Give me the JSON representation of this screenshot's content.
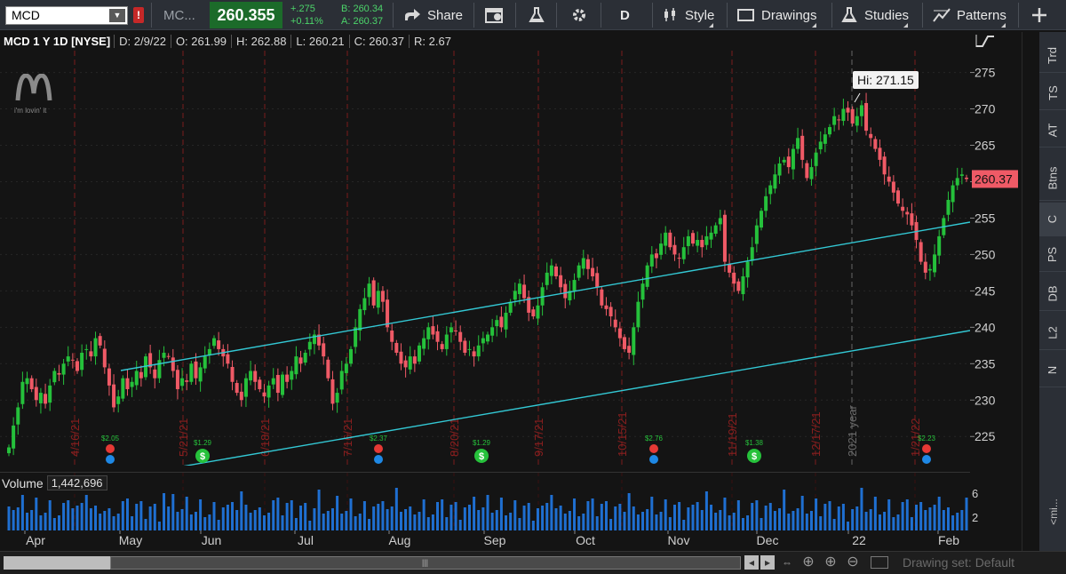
{
  "toolbar": {
    "symbol": "MCD",
    "alert_flag": "!",
    "quote_symbol": "MC...",
    "last_price": "260.355",
    "net_change": "+.275",
    "pct_change": "+0.11%",
    "bid": "B: 260.34",
    "ask": "A: 260.37",
    "share": "Share",
    "aggregation": "D",
    "style": "Style",
    "drawings": "Drawings",
    "studies": "Studies",
    "patterns": "Patterns"
  },
  "header": {
    "title": "MCD 1 Y 1D [NYSE]",
    "date": "D: 2/9/22",
    "open": "O: 261.99",
    "high": "H: 262.88",
    "low": "L: 260.21",
    "close": "C: 260.37",
    "range": "R: 2.67"
  },
  "logo": {
    "tagline": "i'm lovin' it"
  },
  "chart_data": {
    "type": "candlestick",
    "title": "MCD 1 Y 1D [NYSE]",
    "price_ylim": [
      221,
      278
    ],
    "price_ticks": [
      225,
      230,
      235,
      240,
      245,
      250,
      255,
      260,
      265,
      270,
      275
    ],
    "volume_ticks": [
      "6",
      "2"
    ],
    "last_price_label": "260.37",
    "high_label": "Hi: 271.15",
    "month_labels": [
      "Apr",
      "May",
      "Jun",
      "Jul",
      "Aug",
      "Sep",
      "Oct",
      "Nov",
      "Dec",
      "22",
      "Feb"
    ],
    "period_markers": [
      "4/16/21",
      "5/21/21",
      "6/18/21",
      "7/16/21",
      "8/20/21",
      "9/17/21",
      "10/15/21",
      "11/19/21",
      "12/17/21",
      "1/21/22"
    ],
    "year_marker": "2021 year",
    "dividends": [
      "$1.29",
      "$1.29",
      "$1.29",
      "$1.38"
    ],
    "earnings": [
      "$2.05",
      "$2.37",
      "$2.76",
      "$2.23"
    ],
    "closes": [
      223.5,
      226.5,
      229,
      232.5,
      233,
      231.5,
      230,
      231,
      229.5,
      232,
      234,
      233.5,
      235,
      236,
      235.5,
      234,
      236.5,
      237,
      236,
      238.5,
      237.5,
      234.5,
      232,
      229,
      230.5,
      233,
      231.5,
      232.5,
      234,
      233,
      236,
      234.5,
      233,
      235.5,
      236.5,
      236,
      234,
      231.5,
      233,
      232.5,
      235,
      233,
      234.5,
      236,
      237,
      238.5,
      237,
      236,
      235,
      232.5,
      231,
      230,
      233,
      234,
      232.5,
      231.5,
      230.5,
      232,
      233,
      231,
      233.5,
      232.5,
      234,
      236,
      235,
      236.5,
      238,
      239,
      237.5,
      236,
      233,
      229.5,
      231,
      234,
      235,
      237,
      240,
      242.5,
      244,
      246,
      243,
      245,
      243.5,
      240,
      238,
      236.5,
      235,
      234.5,
      236,
      235,
      237.5,
      238.5,
      240,
      239,
      238,
      237,
      239,
      240,
      239.5,
      238,
      236.5,
      237,
      236,
      237.5,
      238.5,
      239,
      240,
      241,
      240,
      242,
      243.5,
      245,
      246,
      244,
      242,
      241.5,
      243,
      245.5,
      247.5,
      248.5,
      247,
      245.5,
      244,
      245,
      246.5,
      248.5,
      249.5,
      248,
      247,
      245.5,
      243,
      242.5,
      241.5,
      240,
      238.5,
      237,
      236.5,
      240,
      243.5,
      246,
      248.5,
      250,
      249.5,
      251.5,
      253,
      251,
      250,
      249.5,
      251,
      252.5,
      251.5,
      252,
      251,
      252.5,
      253,
      254,
      255,
      249,
      247.5,
      246,
      245,
      247,
      249,
      251,
      254,
      256,
      258,
      259.5,
      261,
      262.5,
      263,
      262,
      264.5,
      266,
      263,
      260.5,
      262,
      264,
      265.5,
      266.5,
      267.5,
      269,
      268.5,
      270,
      269.5,
      268,
      269,
      270.5,
      267,
      266,
      264.5,
      263,
      261,
      260,
      258.5,
      257,
      256,
      255.5,
      254,
      252,
      249,
      247.5,
      248,
      250,
      252.5,
      255,
      257.5,
      259.5,
      260.5,
      261,
      260.37
    ],
    "upper_channel": [
      [
        136,
        360
      ],
      [
        1092,
        193
      ]
    ],
    "lower_channel": [
      [
        25,
        499
      ],
      [
        1092,
        315
      ]
    ]
  },
  "volume": {
    "label": "Volume",
    "value": "1,442,696"
  },
  "right_tabs": [
    "Trd",
    "TS",
    "AT",
    "Btns",
    "C",
    "PS",
    "DB",
    "L2",
    "N"
  ],
  "right_collapsed": "<mi...",
  "bottom": {
    "drawing_set": "Drawing set: Default"
  }
}
